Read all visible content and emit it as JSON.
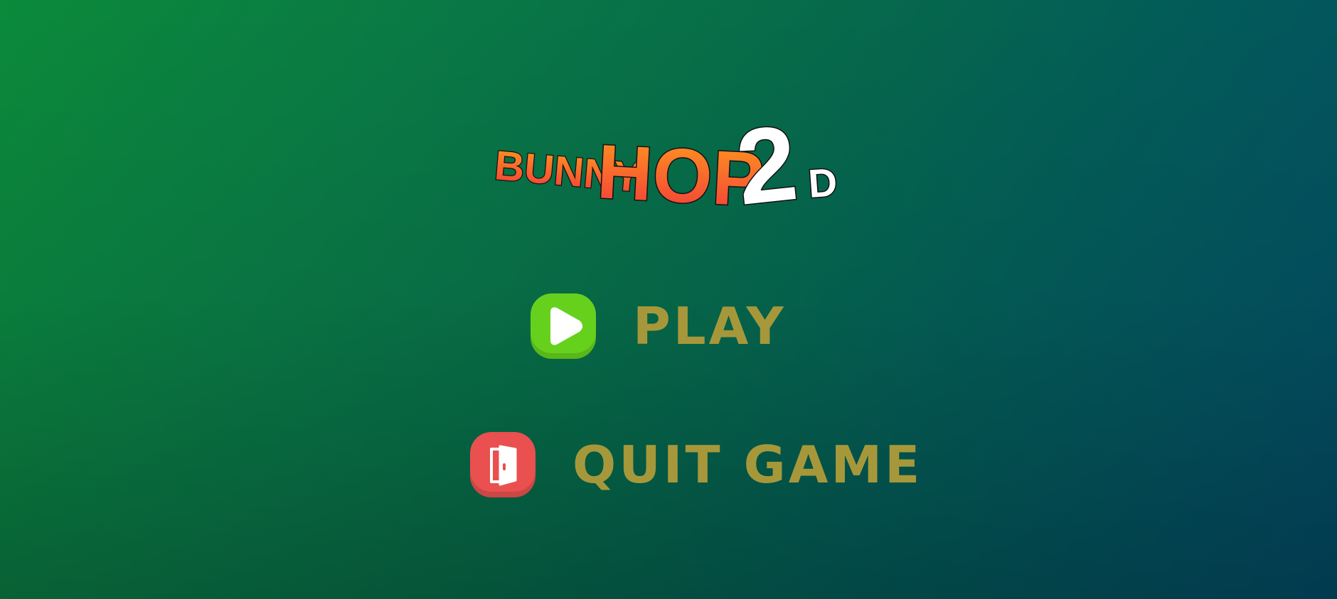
{
  "game": {
    "logo": {
      "word1": "BUNNY",
      "word2": "HOP",
      "badge_digit": "2",
      "badge_letter": "D"
    }
  },
  "menu": {
    "play": {
      "label": "PLAY",
      "icon": "play-icon"
    },
    "quit": {
      "label": "QUIT GAME",
      "icon": "door-exit-icon"
    }
  },
  "colors": {
    "background_start": "#0b8a3a",
    "background_end": "#034a66",
    "menu_text": "#a6983a",
    "play_button": "#66d11d",
    "quit_button": "#e9504f",
    "logo_gradient_top": "#ff9a1f",
    "logo_gradient_bottom": "#f23a3a"
  }
}
